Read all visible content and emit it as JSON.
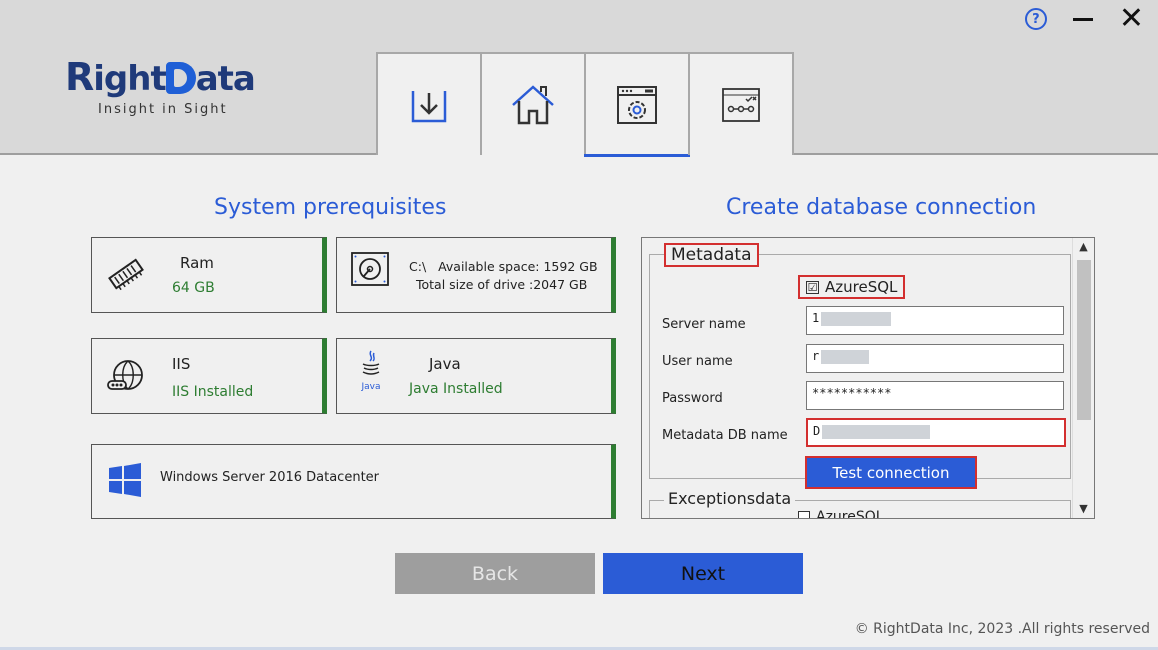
{
  "window": {
    "help_label": "?",
    "minimize_label": "–",
    "close_label": "✕"
  },
  "logo": {
    "r": "R",
    "ight": "ight",
    "ata": "ata",
    "tagline": "Insight in Sight"
  },
  "tabs": [
    {
      "icon": "download-icon",
      "active": false
    },
    {
      "icon": "home-icon",
      "active": false
    },
    {
      "icon": "settings-window-icon",
      "active": true
    },
    {
      "icon": "connection-icon",
      "active": false
    }
  ],
  "prereq": {
    "title": "System prerequisites",
    "ram": {
      "label": "Ram",
      "value": "64 GB"
    },
    "drive": {
      "line1": "C:\\   Available space: 1592 GB",
      "line2": "Total size of drive :2047 GB"
    },
    "iis": {
      "label": "IIS",
      "value": "IIS Installed"
    },
    "java": {
      "label": "Java",
      "value": "Java Installed",
      "icon_text": "Java"
    },
    "os": {
      "label": "Windows Server 2016 Datacenter"
    }
  },
  "db": {
    "title": "Create database connection",
    "metadata": {
      "legend": "Metadata",
      "checkbox_label": "AzureSQL",
      "checked_mark": "☑",
      "server_label": "Server name",
      "server_value": "1",
      "user_label": "User name",
      "user_value": "r",
      "password_label": "Password",
      "password_value": "***********",
      "dbname_label": "Metadata DB name",
      "dbname_value": "D",
      "test_button": "Test connection"
    },
    "exceptions": {
      "legend": "Exceptionsdata",
      "checkbox_label": "AzureSQL"
    }
  },
  "nav": {
    "back": "Back",
    "next": "Next"
  },
  "footer": "© RightData Inc, 2023 .All rights reserved",
  "colors": {
    "accent": "#2b5cd6",
    "status_green": "#2e7d32",
    "highlight_red": "#d32f2f"
  }
}
